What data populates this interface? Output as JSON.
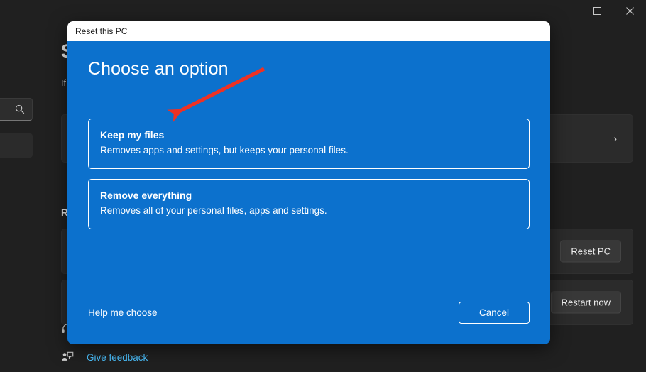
{
  "settings_window": {
    "window_controls": [
      {
        "name": "minimize-button",
        "glyph": "minimize"
      },
      {
        "name": "maximize-button",
        "glyph": "maximize"
      },
      {
        "name": "close-button",
        "glyph": "close"
      }
    ],
    "search": {
      "placeholder": "",
      "value": "",
      "icon": "search-icon"
    },
    "page_title": "S",
    "page_subtitle": "If",
    "section_heading": "R",
    "cards": [
      {
        "name": "recovery-card",
        "chevron": "›"
      },
      {
        "name": "reset-pc-card",
        "button_label": "Reset PC"
      },
      {
        "name": "restart-now-card",
        "button_label": "Restart now"
      }
    ],
    "bottom_links": [
      {
        "name": "get-help-link",
        "label": "",
        "icon": "headset-icon"
      },
      {
        "name": "give-feedback-link",
        "label": "Give feedback",
        "icon": "feedback-person-icon"
      }
    ]
  },
  "dialog": {
    "title": "Reset this PC",
    "heading": "Choose an option",
    "options": [
      {
        "name": "keep-my-files-option",
        "title": "Keep my files",
        "description": "Removes apps and settings, but keeps your personal files."
      },
      {
        "name": "remove-everything-option",
        "title": "Remove everything",
        "description": "Removes all of your personal files, apps and settings."
      }
    ],
    "help_link": "Help me choose",
    "cancel_label": "Cancel"
  },
  "annotation": {
    "arrow_color": "#ee3124",
    "points_at": "Keep my files"
  },
  "colors": {
    "dialog_blue": "#0c71cd",
    "window_background": "#202020",
    "card_background": "#2b2b2b",
    "accent_link": "#4cc2ff"
  }
}
